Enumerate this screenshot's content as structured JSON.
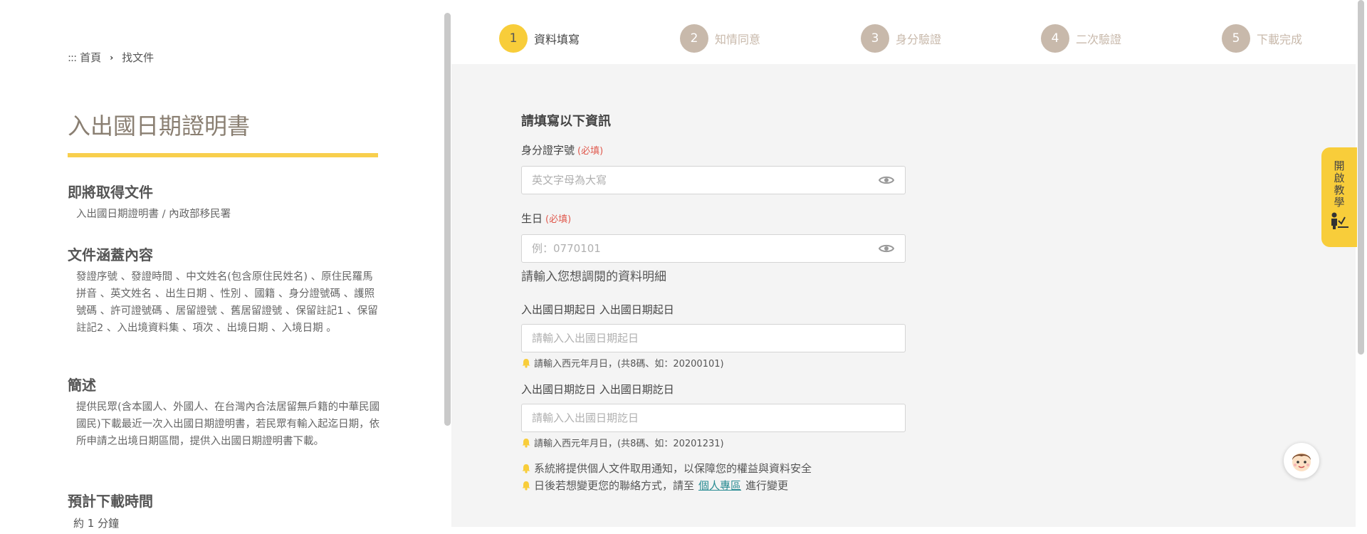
{
  "breadcrumb": {
    "dots": ":::",
    "home": "首頁",
    "current": "找文件"
  },
  "doc": {
    "title": "入出國日期證明書",
    "sections": {
      "obtain": {
        "heading": "即將取得文件",
        "text": "入出國日期證明書 / 內政部移民署"
      },
      "coverage": {
        "heading": "文件涵蓋內容",
        "text": "發證序號 、發證時間 、中文姓名(包含原住民姓名) 、原住民羅馬拼音 、英文姓名 、出生日期 、性別 、國籍 、身分證號碼 、護照號碼 、許可證號碼 、居留證號 、舊居留證號 、保留註記1 、保留註記2 、入出境資料集 、項次 、出境日期 、入境日期 。"
      },
      "summary": {
        "heading": "簡述",
        "text": "提供民眾(含本國人、外國人、在台灣內合法居留無戶籍的中華民國國民)下載最近一次入出國日期證明書，若民眾有輸入起迄日期，依所申請之出境日期區間，提供入出國日期證明書下載。"
      },
      "time": {
        "heading": "預計下載時間",
        "text": "約 1 分鐘"
      }
    }
  },
  "steps": [
    {
      "num": "1",
      "label": "資料填寫",
      "active": true
    },
    {
      "num": "2",
      "label": "知情同意"
    },
    {
      "num": "3",
      "label": "身分驗證"
    },
    {
      "num": "4",
      "label": "二次驗證"
    },
    {
      "num": "5",
      "label": "下載完成"
    }
  ],
  "form": {
    "heading": "請填寫以下資訊",
    "id_label": "身分證字號",
    "required": "(必填)",
    "id_placeholder": "英文字母為大寫",
    "birth_label": "生日",
    "birth_placeholder": "例：0770101",
    "detail_text": "請輸入您想調閱的資料明細",
    "start_label": "入出國日期起日 入出國日期起日",
    "start_placeholder": "請輸入入出國日期起日",
    "start_hint": "請輸入西元年月日，(共8碼、如：20200101)",
    "end_label": "入出國日期訖日 入出國日期訖日",
    "end_placeholder": "請輸入入出國日期訖日",
    "end_hint": "請輸入西元年月日，(共8碼、如：20201231)",
    "note1": "系統將提供個人文件取用通知，以保障您的權益與資料安全",
    "note2_pre": "日後若想變更您的聯絡方式，請至",
    "note2_link": "個人專區",
    "note2_post": "進行變更"
  },
  "tutorial": {
    "label": "開啟教學"
  },
  "colors": {
    "accent": "#f8cd3a",
    "step_inactive": "#c8b9ab",
    "required": "#e05a4e",
    "link": "#2a8c93"
  }
}
